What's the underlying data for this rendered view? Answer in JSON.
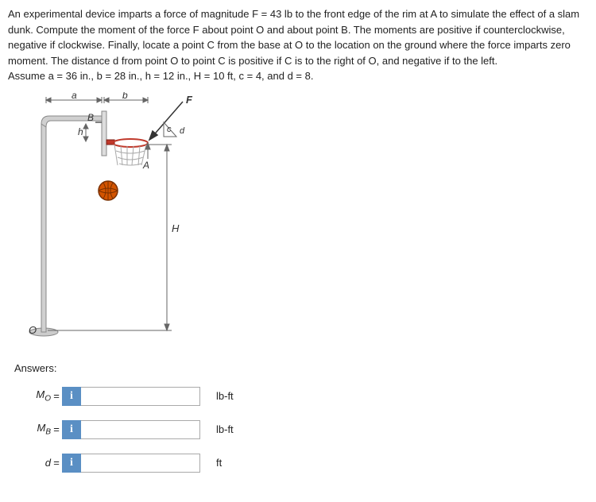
{
  "problem": {
    "p1": "An experimental device imparts a force of magnitude F = 43 lb to the front edge of the rim at A to simulate the effect of a slam dunk. Compute the moment of the force F about point O and about point B. The moments are positive if counterclockwise, negative if clockwise. Finally, locate a point C from the base at O to the location on the ground where the force imparts zero moment. The distance d from point O to point C is positive if C is to the right of O, and negative if to the left.",
    "p2": "Assume a = 36 in., b = 28 in., h = 12 in., H = 10 ft, c = 4, and d = 8."
  },
  "figure": {
    "labels": {
      "a": "a",
      "b": "b",
      "B": "B",
      "h": "h",
      "F": "F",
      "A": "A",
      "c": "c",
      "d": "d",
      "H": "H",
      "O": "O"
    }
  },
  "answers_label": "Answers:",
  "answers": [
    {
      "var_html": "M<sub>O</sub>",
      "eq": "=",
      "info": "i",
      "value": "",
      "unit": "lb-ft"
    },
    {
      "var_html": "M<sub>B</sub>",
      "eq": "=",
      "info": "i",
      "value": "",
      "unit": "lb-ft"
    },
    {
      "var_html": "d",
      "eq": "=",
      "info": "i",
      "value": "",
      "unit": "ft"
    }
  ]
}
